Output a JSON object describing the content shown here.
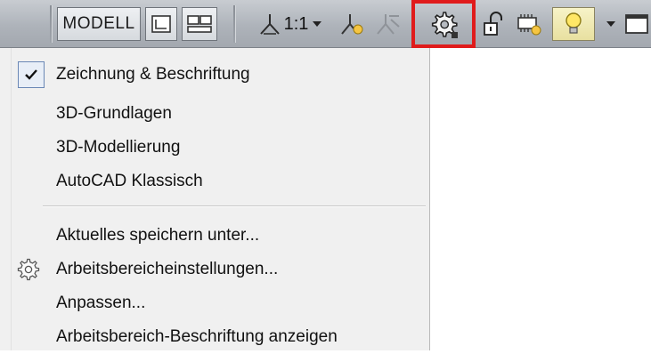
{
  "statusbar": {
    "model_label": "MODELL",
    "scale_label": "1:1",
    "icons": [
      "model-layout-icon",
      "layout-icon",
      "annotation-scale-icon",
      "annotation-visibility-icon",
      "auto-scale-icon",
      "workspace-gear-icon",
      "lock-icon",
      "hardware-acceleration-icon",
      "isolate-objects-icon",
      "status-menu-icon",
      "clean-screen-icon"
    ],
    "highlight_color": "#e01b1b"
  },
  "menu": {
    "workspaces": [
      {
        "label": "Zeichnung & Beschriftung",
        "checked": true
      },
      {
        "label": "3D-Grundlagen",
        "checked": false
      },
      {
        "label": "3D-Modellierung",
        "checked": false
      },
      {
        "label": "AutoCAD Klassisch",
        "checked": false
      }
    ],
    "actions": [
      {
        "label": "Aktuelles speichern unter..."
      },
      {
        "label": "Arbeitsbereicheinstellungen...",
        "icon": "gear-icon"
      },
      {
        "label": "Anpassen..."
      },
      {
        "label": "Arbeitsbereich-Beschriftung anzeigen"
      }
    ]
  }
}
